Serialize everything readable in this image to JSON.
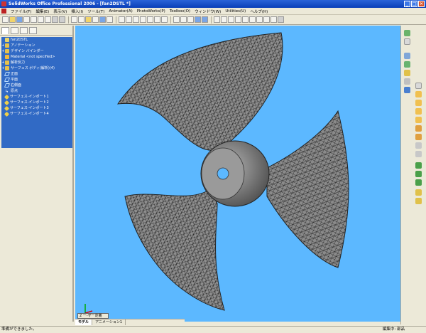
{
  "window": {
    "title": "SolidWorks Office Professional 2006 - [fan2DSTL *]",
    "controls": {
      "minimize": "_",
      "maximize": "□",
      "close": "×"
    }
  },
  "menu": {
    "items": [
      "ファイル(F)",
      "編集(E)",
      "表示(V)",
      "挿入(I)",
      "ツール(T)",
      "Animator(A)",
      "PhotoWorks(P)",
      "Toolbox(O)",
      "ウィンドウ(W)",
      "Utilities(U)",
      "ヘルプ(H)"
    ]
  },
  "feature_tree": {
    "root": "fan2DSTL",
    "items": [
      {
        "label": "アノテーション",
        "icon": "annotations-icon",
        "expand": "+"
      },
      {
        "label": "デザイン バインダー",
        "icon": "design-binder-icon",
        "expand": "+"
      },
      {
        "label": "Material <not specified>",
        "icon": "material-icon",
        "expand": ""
      },
      {
        "label": "解析反力",
        "icon": "folder-icon",
        "expand": "+"
      },
      {
        "label": "サーフェス ボディ(解析)(4)",
        "icon": "folder-icon",
        "expand": "+"
      },
      {
        "label": "正面",
        "icon": "plane-icon",
        "expand": ""
      },
      {
        "label": "平面",
        "icon": "plane-icon",
        "expand": ""
      },
      {
        "label": "右側面",
        "icon": "plane-icon",
        "expand": ""
      },
      {
        "label": "原点",
        "icon": "origin-icon",
        "expand": ""
      },
      {
        "label": "サーフェス-インポート1",
        "icon": "surface-import-icon",
        "expand": ""
      },
      {
        "label": "サーフェス-インポート2",
        "icon": "surface-import-icon",
        "expand": ""
      },
      {
        "label": "サーフェス-インポート3",
        "icon": "surface-import-icon",
        "expand": ""
      },
      {
        "label": "サーフェス-インポート4",
        "icon": "surface-import-icon",
        "expand": ""
      }
    ]
  },
  "bottom": {
    "model_chip": "2 ー-ザー定義",
    "tabs": [
      "モデル",
      "アニメーション1"
    ]
  },
  "status": {
    "left": "準備ができました。",
    "right_1": "編集中: 部品",
    "right_2": ""
  },
  "colors": {
    "viewport_bg": "#5cb8ff",
    "tree_bg": "#316ac5",
    "mesh_face": "#8c8c8c",
    "mesh_line": "#1a1a1a"
  }
}
